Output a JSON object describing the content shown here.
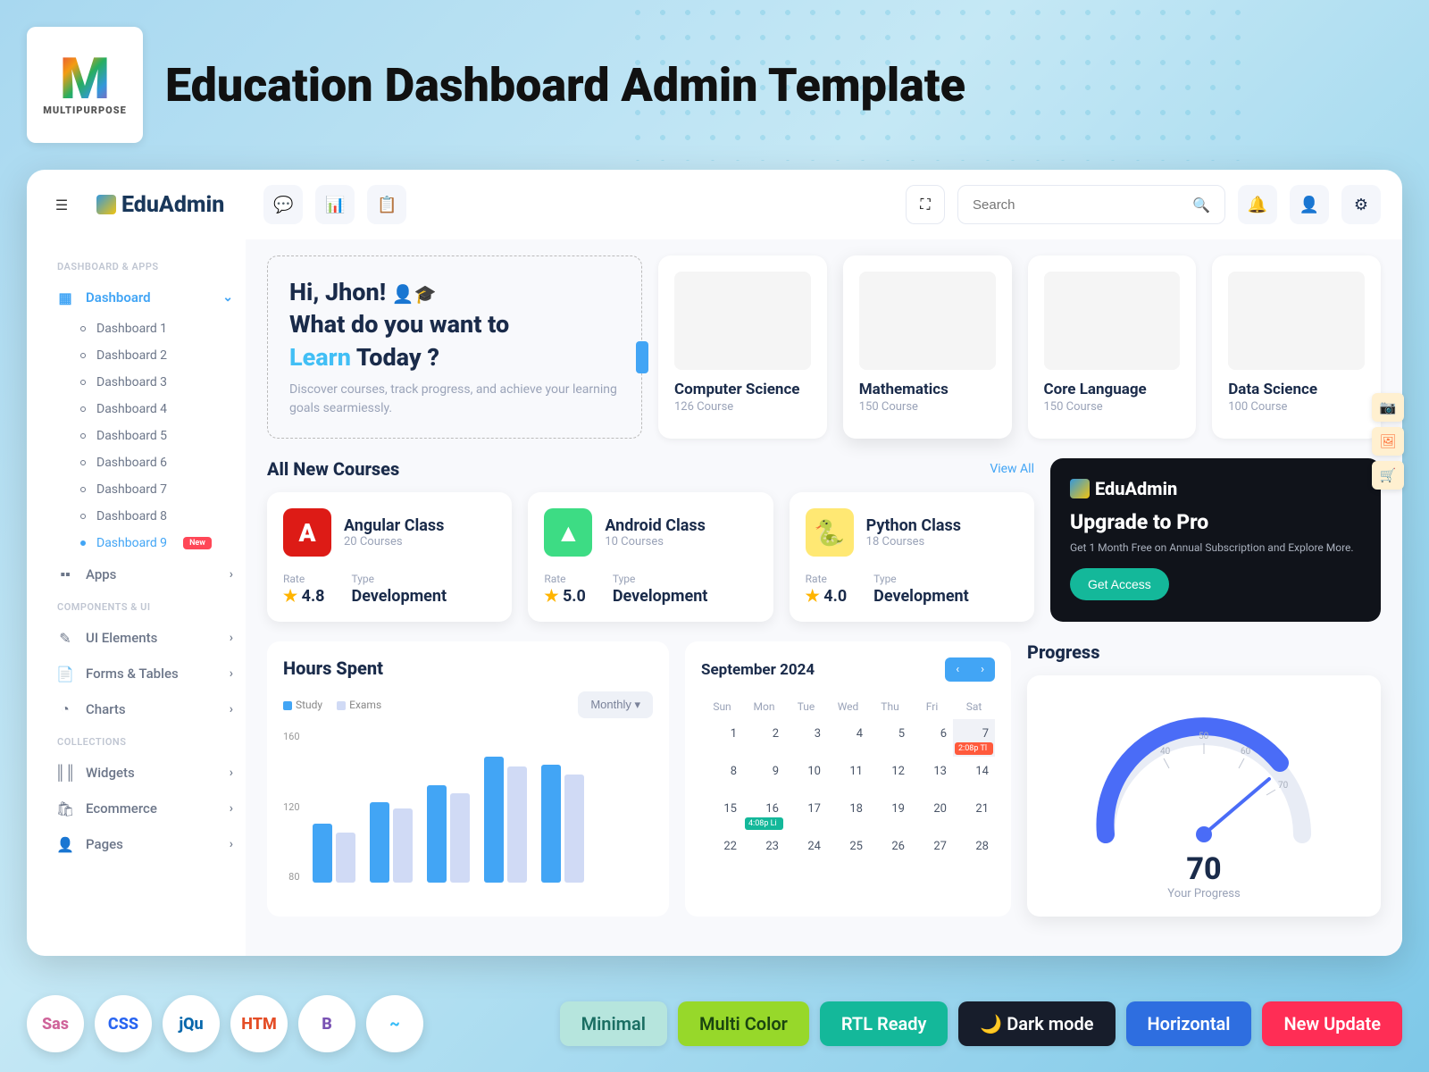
{
  "banner": {
    "title": "Education Dashboard Admin Template",
    "logo_sub": "MULTIPURPOSE"
  },
  "brand": "EduAdmin",
  "search": {
    "placeholder": "Search"
  },
  "sidebar": {
    "sec1": "DASHBOARD & APPS",
    "dashboard": "Dashboard",
    "subs": [
      {
        "label": "Dashboard 1"
      },
      {
        "label": "Dashboard 2"
      },
      {
        "label": "Dashboard 3"
      },
      {
        "label": "Dashboard 4"
      },
      {
        "label": "Dashboard 5"
      },
      {
        "label": "Dashboard 6"
      },
      {
        "label": "Dashboard 7"
      },
      {
        "label": "Dashboard 8"
      },
      {
        "label": "Dashboard 9"
      }
    ],
    "new_badge": "New",
    "apps": "Apps",
    "sec2": "COMPONENTS & UI",
    "ui": "UI Elements",
    "forms": "Forms & Tables",
    "charts": "Charts",
    "sec3": "COLLECTIONS",
    "widgets": "Widgets",
    "ecom": "Ecommerce",
    "pages": "Pages"
  },
  "hero": {
    "greeting": "Hi, Jhon!",
    "l1": "What do you want to",
    "learn": "Learn",
    "l2": "Today ?",
    "sub": "Discover courses, track progress, and achieve your learning goals searmiessly."
  },
  "cats": [
    {
      "title": "Computer Science",
      "sub": "126 Course"
    },
    {
      "title": "Mathematics",
      "sub": "150 Course"
    },
    {
      "title": "Core Language",
      "sub": "150 Course"
    },
    {
      "title": "Data Science",
      "sub": "100 Course"
    }
  ],
  "courses": {
    "title": "All New Courses",
    "view_all": "View All",
    "items": [
      {
        "name": "Angular Class",
        "count": "20 Courses",
        "rate": "4.8",
        "type": "Development",
        "color": "#dd1b16",
        "fg": "#fff",
        "glyph": "A"
      },
      {
        "name": "Android Class",
        "count": "10 Courses",
        "rate": "5.0",
        "type": "Development",
        "color": "#3ddc84",
        "fg": "#fff",
        "glyph": "▲"
      },
      {
        "name": "Python Class",
        "count": "18 Courses",
        "rate": "4.0",
        "type": "Development",
        "color": "#ffe873",
        "fg": "#306998",
        "glyph": "🐍"
      }
    ],
    "rate_label": "Rate",
    "type_label": "Type"
  },
  "upgrade": {
    "brand": "EduAdmin",
    "title": "Upgrade to Pro",
    "sub": "Get 1 Month Free on Annual Subscription and Explore More.",
    "btn": "Get Access"
  },
  "hours": {
    "title": "Hours Spent",
    "legend_study": "Study",
    "legend_exams": "Exams",
    "dropdown": "Monthly"
  },
  "chart_data": {
    "type": "bar",
    "y_ticks": [
      160,
      120,
      80
    ],
    "ylim": [
      80,
      170
    ],
    "series": [
      {
        "name": "Study",
        "color": "#42a5f5",
        "values": [
          115,
          128,
          138,
          155,
          150
        ]
      },
      {
        "name": "Exams",
        "color": "#d0daf5",
        "values": [
          110,
          124,
          133,
          149,
          144
        ]
      }
    ]
  },
  "calendar": {
    "title": "September 2024",
    "dow": [
      "Sun",
      "Mon",
      "Tue",
      "Wed",
      "Thu",
      "Fri",
      "Sat"
    ],
    "rows": [
      [
        1,
        2,
        3,
        4,
        5,
        6,
        7
      ],
      [
        8,
        9,
        10,
        11,
        12,
        13,
        14
      ],
      [
        15,
        16,
        17,
        18,
        19,
        20,
        21
      ],
      [
        22,
        23,
        24,
        25,
        26,
        27,
        28
      ]
    ],
    "today": 7,
    "events": [
      {
        "day": 7,
        "label": "2:08p Tl",
        "color": "#ff5a3c"
      },
      {
        "day": 16,
        "label": "4:08p Li",
        "color": "#14b89a"
      }
    ]
  },
  "progress": {
    "title": "Progress",
    "value": "70",
    "label": "Your Progress",
    "ticks": [
      "40",
      "50",
      "60",
      "70"
    ]
  },
  "footer": {
    "tech": [
      "Sass",
      "CSS",
      "jQuery",
      "HTML",
      "B",
      "~"
    ],
    "tags": [
      {
        "label": "Minimal",
        "bg": "#b6e5dd",
        "fg": "#1a6e63"
      },
      {
        "label": "Multi Color",
        "bg": "#97d82a",
        "fg": "#1a4510"
      },
      {
        "label": "RTL Ready",
        "bg": "#14b89a",
        "fg": "#fff"
      },
      {
        "label": "Dark mode",
        "bg": "#171d2b",
        "fg": "#fff"
      },
      {
        "label": "Horizontal",
        "bg": "#2e6ee0",
        "fg": "#fff"
      },
      {
        "label": "New Update",
        "bg": "#ff2d55",
        "fg": "#fff"
      }
    ]
  }
}
